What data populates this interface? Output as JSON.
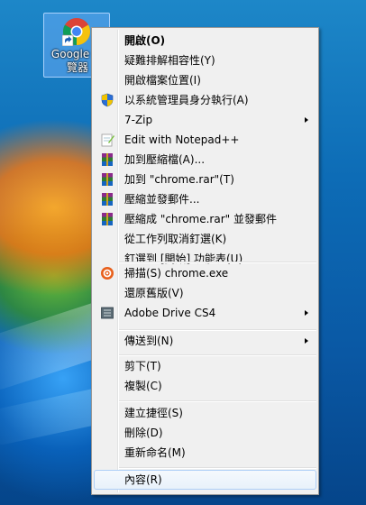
{
  "desktop_icon": {
    "label": "Google 瀏覽器",
    "icon": "chrome-shortcut-icon"
  },
  "context_menu": {
    "items": [
      {
        "label": "開啟(O)",
        "bold": true
      },
      {
        "label": "疑難排解相容性(Y)"
      },
      {
        "label": "開啟檔案位置(I)"
      },
      {
        "label": "以系統管理員身分執行(A)",
        "icon": "uac-shield-icon"
      },
      {
        "label": "7-Zip",
        "submenu": true
      },
      {
        "label": "Edit with Notepad++",
        "icon": "notepad-plus-plus-icon"
      },
      {
        "label": "加到壓縮檔(A)...",
        "icon": "winrar-icon"
      },
      {
        "label": "加到 \"chrome.rar\"(T)",
        "icon": "winrar-icon"
      },
      {
        "label": "壓縮並發郵件...",
        "icon": "winrar-icon"
      },
      {
        "label": "壓縮成 \"chrome.rar\" 並發郵件",
        "icon": "winrar-icon"
      },
      {
        "label": "從工作列取消釘選(K)"
      },
      {
        "label": "釘選到 [開始] 功能表(U)"
      },
      {
        "label": "掃描(S) chrome.exe",
        "icon": "antivirus-scan-icon"
      },
      {
        "label": "還原舊版(V)"
      },
      {
        "label": "Adobe Drive CS4",
        "icon": "adobe-drive-icon",
        "submenu": true
      },
      {
        "label": "傳送到(N)",
        "submenu": true
      },
      {
        "label": "剪下(T)"
      },
      {
        "label": "複製(C)"
      },
      {
        "label": "建立捷徑(S)"
      },
      {
        "label": "刪除(D)"
      },
      {
        "label": "重新命名(M)"
      },
      {
        "label": "內容(R)",
        "highlighted": true
      }
    ]
  },
  "colors": {
    "menu_bg": "#f0f0f0",
    "highlight_border": "#aecff7",
    "desktop_blue": "#0d6cb6"
  }
}
